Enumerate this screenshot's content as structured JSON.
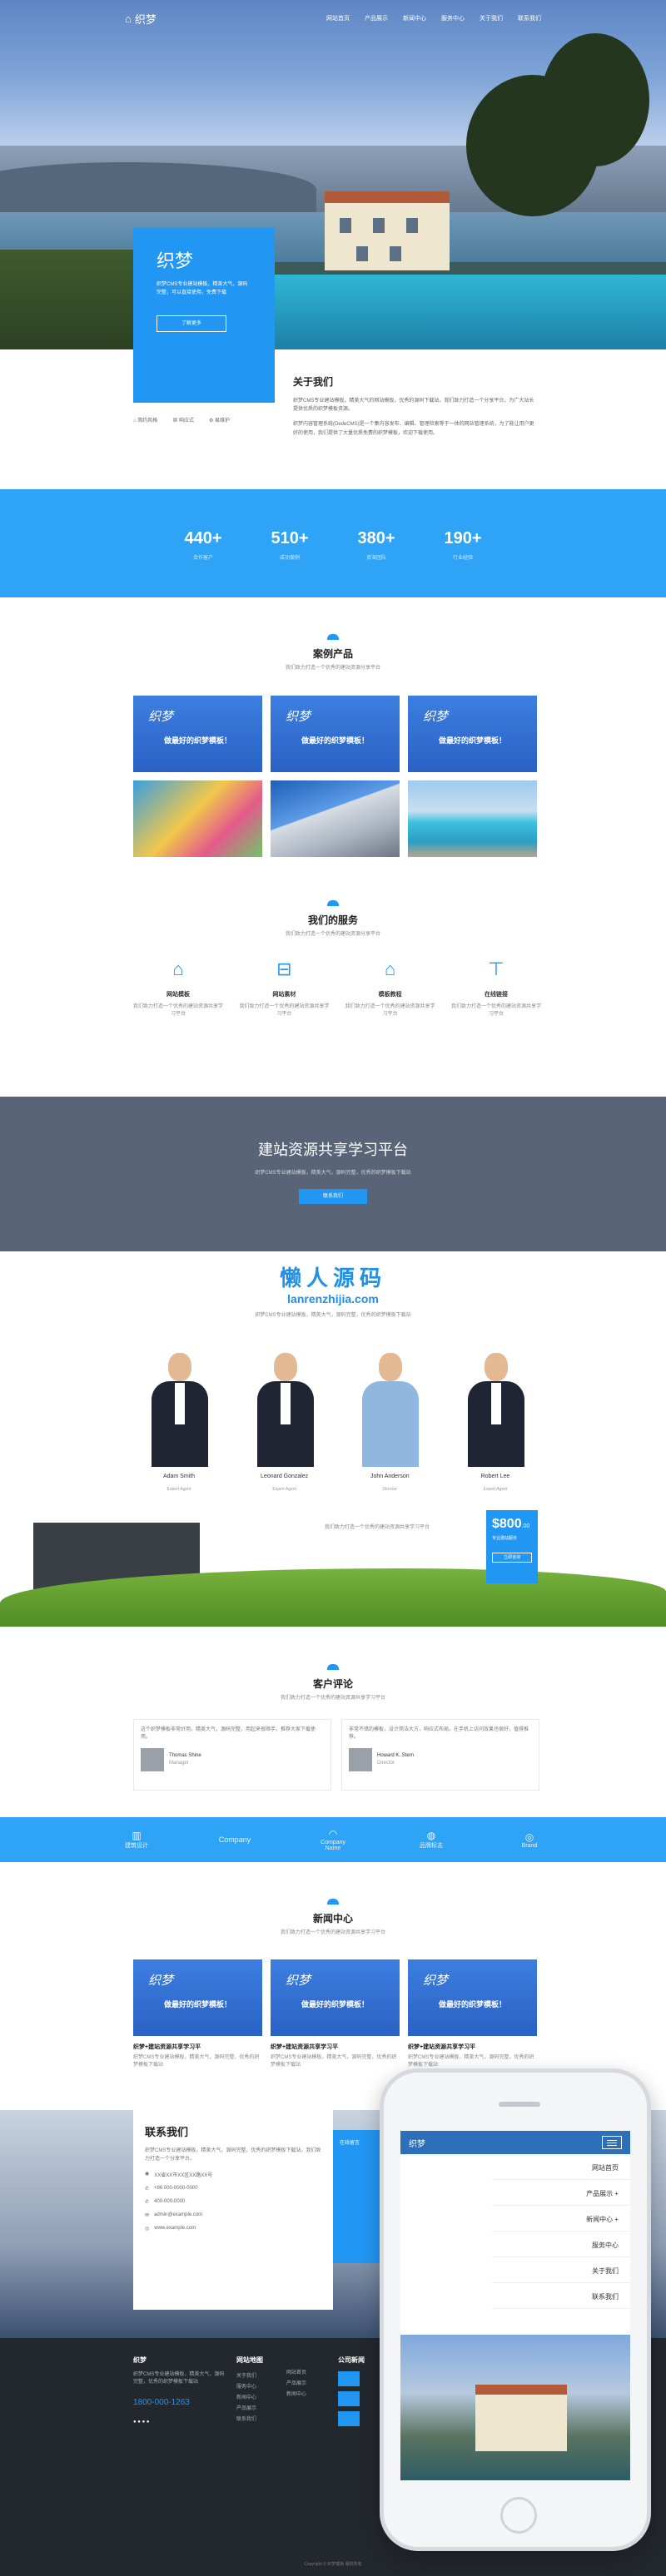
{
  "header": {
    "logo_text": "织梦",
    "nav": [
      "网站首页",
      "产品展示",
      "新闻中心",
      "服务中心",
      "关于我们",
      "联系我们"
    ]
  },
  "hero": {
    "card_title": "织梦",
    "card_text": "织梦CMS专业建站模板，精美大气，源码完整，可以直接使用，免费下载",
    "card_button": "了解更多"
  },
  "features": [
    "简约风格",
    "响应式",
    "易维护"
  ],
  "about": {
    "title": "关于我们",
    "p1": "织梦CMS专业建站模板，精美大气的网站模板，优秀的源码下载站，我们致力打造一个分享平台，为广大站长提供优质的织梦模板资源。",
    "p2": "织梦内容管理系统(DedeCMS)是一个集内容发布、编辑、管理检索等于一体的网站管理系统，为了能让用户更好的使用，我们提供了大量优质免费的织梦模板，欢迎下载使用。"
  },
  "stats": [
    {
      "num": "440+",
      "label": "合作客户"
    },
    {
      "num": "510+",
      "label": "成功案例"
    },
    {
      "num": "380+",
      "label": "资深团队"
    },
    {
      "num": "190+",
      "label": "行业经验"
    }
  ],
  "cases": {
    "title": "案例产品",
    "subtitle": "我们致力打造一个优秀的建站资源分享平台",
    "tpl_t1": "织梦",
    "tpl_t2": "做最好的织梦模板！"
  },
  "services": {
    "title": "我们的服务",
    "subtitle": "我们致力打造一个优秀的建站资源分享平台",
    "items": [
      {
        "name": "网站模板",
        "desc": "我们致力打造一个优秀的建站资源共享学习平台"
      },
      {
        "name": "网站素材",
        "desc": "我们致力打造一个优秀的建站资源共享学习平台"
      },
      {
        "name": "模板教程",
        "desc": "我们致力打造一个优秀的建站资源共享学习平台"
      },
      {
        "name": "在线链接",
        "desc": "我们致力打造一个优秀的建站资源共享学习平台"
      }
    ]
  },
  "band": {
    "title": "建站资源共享学习平台",
    "text": "织梦CMS专业建站模板，精美大气，源码完整，优秀的织梦模板下载站",
    "button": "联系我们"
  },
  "watermark": {
    "w1": "懒人源码",
    "w2": "lanrenzhijia.com"
  },
  "team": {
    "subtitle": "织梦CMS专业建站模板，精美大气，源码完整，优秀的织梦模板下载站",
    "members": [
      {
        "name": "Adam Smith",
        "role": "Expert Agent"
      },
      {
        "name": "Leonard Gonzalez",
        "role": "Expert Agent"
      },
      {
        "name": "John Anderson",
        "role": "Director"
      },
      {
        "name": "Robert Lee",
        "role": "Expert Agent"
      }
    ]
  },
  "promo": {
    "text": "我们致力打造一个优秀的建站资源共享学习平台",
    "price": "$800",
    "price_sub": ".00",
    "price_note": "专业建站服务",
    "button": "立即咨询"
  },
  "reviews": {
    "title": "客户评论",
    "subtitle": "我们致力打造一个优秀的建站资源共享学习平台",
    "items": [
      {
        "text": "这个织梦模板非常好用，精美大气，源码完整，用起来很顺手，推荐大家下载使用。",
        "name": "Thomas Shine",
        "role": "Manager"
      },
      {
        "text": "非常不错的模板，设计简洁大方，响应式布局，在手机上访问效果也很好，值得推荐。",
        "name": "Howard K. Stern",
        "role": "Director"
      }
    ]
  },
  "logos": [
    {
      "g": "▥",
      "t": "建筑设计"
    },
    {
      "g": "Company",
      "t": "Company"
    },
    {
      "g": "◠",
      "t": "Company Name"
    },
    {
      "g": "◍",
      "t": "品牌标志"
    },
    {
      "g": "◎",
      "t": "Brand"
    }
  ],
  "news": {
    "title": "新闻中心",
    "subtitle": "我们致力打造一个优秀的建站资源共享学习平台",
    "items": [
      {
        "title": "织梦+建站资源共享学习平",
        "desc": "织梦CMS专业建站模板，精美大气，源码完整，优秀的织梦模板下载站"
      },
      {
        "title": "织梦+建站资源共享学习平",
        "desc": "织梦CMS专业建站模板，精美大气，源码完整，优秀的织梦模板下载站"
      },
      {
        "title": "织梦+建站资源共享学习平",
        "desc": "织梦CMS专业建站模板，精美大气，源码完整，优秀的织梦模板下载站"
      }
    ]
  },
  "contact": {
    "title": "联系我们",
    "text": "织梦CMS专业建站模板，精美大气，源码完整，优秀的织梦模板下载站，我们致力打造一个分享平台。",
    "rows": [
      "XX省XX市XX区XX路XX号",
      "+86 000-0000-0000",
      "400-000-0000",
      "admin@example.com",
      "www.example.com"
    ],
    "online_title": "在线留言"
  },
  "footer": {
    "about_text": "织梦CMS专业建站模板，精美大气，源码完整，优秀的织梦模板下载站",
    "phone": "1800-000-1263",
    "col1_title": "网站地图",
    "col1": [
      "关于我们",
      "服务中心",
      "新闻中心",
      "产品展示",
      "联系我们"
    ],
    "col2": [
      "网站首页",
      "产品展示",
      "新闻中心"
    ],
    "col3_title": "公司新闻",
    "copyright": "Copyright © 织梦模板 版权所有"
  },
  "mobile": {
    "logo_text": "织梦",
    "menu": [
      "网站首页",
      "产品展示 +",
      "新闻中心 +",
      "服务中心",
      "关于我们",
      "联系我们"
    ]
  },
  "colors": {
    "accent": "#2196f3",
    "band": "#5a6478",
    "footer": "#23272e"
  }
}
